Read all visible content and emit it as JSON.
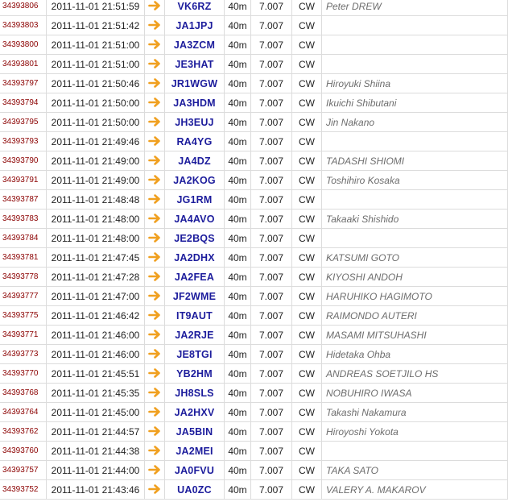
{
  "spots": [
    {
      "id": "34393806",
      "time": "2011-11-01 21:51:59",
      "call": "VK6RZ",
      "band": "40m",
      "freq": "7.007",
      "mode": "CW",
      "name": "Peter DREW"
    },
    {
      "id": "34393803",
      "time": "2011-11-01 21:51:42",
      "call": "JA1JPJ",
      "band": "40m",
      "freq": "7.007",
      "mode": "CW",
      "name": ""
    },
    {
      "id": "34393800",
      "time": "2011-11-01 21:51:00",
      "call": "JA3ZCM",
      "band": "40m",
      "freq": "7.007",
      "mode": "CW",
      "name": ""
    },
    {
      "id": "34393801",
      "time": "2011-11-01 21:51:00",
      "call": "JE3HAT",
      "band": "40m",
      "freq": "7.007",
      "mode": "CW",
      "name": ""
    },
    {
      "id": "34393797",
      "time": "2011-11-01 21:50:46",
      "call": "JR1WGW",
      "band": "40m",
      "freq": "7.007",
      "mode": "CW",
      "name": "Hiroyuki Shiina"
    },
    {
      "id": "34393794",
      "time": "2011-11-01 21:50:00",
      "call": "JA3HDM",
      "band": "40m",
      "freq": "7.007",
      "mode": "CW",
      "name": "Ikuichi Shibutani"
    },
    {
      "id": "34393795",
      "time": "2011-11-01 21:50:00",
      "call": "JH3EUJ",
      "band": "40m",
      "freq": "7.007",
      "mode": "CW",
      "name": "Jin Nakano"
    },
    {
      "id": "34393793",
      "time": "2011-11-01 21:49:46",
      "call": "RA4YG",
      "band": "40m",
      "freq": "7.007",
      "mode": "CW",
      "name": ""
    },
    {
      "id": "34393790",
      "time": "2011-11-01 21:49:00",
      "call": "JA4DZ",
      "band": "40m",
      "freq": "7.007",
      "mode": "CW",
      "name": "TADASHI SHIOMI"
    },
    {
      "id": "34393791",
      "time": "2011-11-01 21:49:00",
      "call": "JA2KOG",
      "band": "40m",
      "freq": "7.007",
      "mode": "CW",
      "name": "Toshihiro Kosaka"
    },
    {
      "id": "34393787",
      "time": "2011-11-01 21:48:48",
      "call": "JG1RM",
      "band": "40m",
      "freq": "7.007",
      "mode": "CW",
      "name": ""
    },
    {
      "id": "34393783",
      "time": "2011-11-01 21:48:00",
      "call": "JA4AVO",
      "band": "40m",
      "freq": "7.007",
      "mode": "CW",
      "name": "Takaaki Shishido"
    },
    {
      "id": "34393784",
      "time": "2011-11-01 21:48:00",
      "call": "JE2BQS",
      "band": "40m",
      "freq": "7.007",
      "mode": "CW",
      "name": ""
    },
    {
      "id": "34393781",
      "time": "2011-11-01 21:47:45",
      "call": "JA2DHX",
      "band": "40m",
      "freq": "7.007",
      "mode": "CW",
      "name": "KATSUMI GOTO"
    },
    {
      "id": "34393778",
      "time": "2011-11-01 21:47:28",
      "call": "JA2FEA",
      "band": "40m",
      "freq": "7.007",
      "mode": "CW",
      "name": "KIYOSHI ANDOH"
    },
    {
      "id": "34393777",
      "time": "2011-11-01 21:47:00",
      "call": "JF2WME",
      "band": "40m",
      "freq": "7.007",
      "mode": "CW",
      "name": "HARUHIKO HAGIMOTO"
    },
    {
      "id": "34393775",
      "time": "2011-11-01 21:46:42",
      "call": "IT9AUT",
      "band": "40m",
      "freq": "7.007",
      "mode": "CW",
      "name": "RAIMONDO AUTERI"
    },
    {
      "id": "34393771",
      "time": "2011-11-01 21:46:00",
      "call": "JA2RJE",
      "band": "40m",
      "freq": "7.007",
      "mode": "CW",
      "name": "MASAMI MITSUHASHI"
    },
    {
      "id": "34393773",
      "time": "2011-11-01 21:46:00",
      "call": "JE8TGI",
      "band": "40m",
      "freq": "7.007",
      "mode": "CW",
      "name": "Hidetaka Ohba"
    },
    {
      "id": "34393770",
      "time": "2011-11-01 21:45:51",
      "call": "YB2HM",
      "band": "40m",
      "freq": "7.007",
      "mode": "CW",
      "name": "ANDREAS SOETJILO HS"
    },
    {
      "id": "34393768",
      "time": "2011-11-01 21:45:35",
      "call": "JH8SLS",
      "band": "40m",
      "freq": "7.007",
      "mode": "CW",
      "name": "NOBUHIRO IWASA"
    },
    {
      "id": "34393764",
      "time": "2011-11-01 21:45:00",
      "call": "JA2HXV",
      "band": "40m",
      "freq": "7.007",
      "mode": "CW",
      "name": "Takashi Nakamura"
    },
    {
      "id": "34393762",
      "time": "2011-11-01 21:44:57",
      "call": "JA5BIN",
      "band": "40m",
      "freq": "7.007",
      "mode": "CW",
      "name": "Hiroyoshi Yokota"
    },
    {
      "id": "34393760",
      "time": "2011-11-01 21:44:38",
      "call": "JA2MEI",
      "band": "40m",
      "freq": "7.007",
      "mode": "CW",
      "name": ""
    },
    {
      "id": "34393757",
      "time": "2011-11-01 21:44:00",
      "call": "JA0FVU",
      "band": "40m",
      "freq": "7.007",
      "mode": "CW",
      "name": "TAKA SATO"
    },
    {
      "id": "34393752",
      "time": "2011-11-01 21:43:46",
      "call": "UA0ZC",
      "band": "40m",
      "freq": "7.007",
      "mode": "CW",
      "name": "VALERY A. MAKAROV"
    }
  ],
  "icons": {
    "arrow": "arrow-right-icon"
  },
  "colors": {
    "spot_id": "#8b0000",
    "callsign": "#1c1c9c",
    "name": "#6d6d6d",
    "arrow": "#f0a020",
    "grid": "#dcdcdc"
  }
}
